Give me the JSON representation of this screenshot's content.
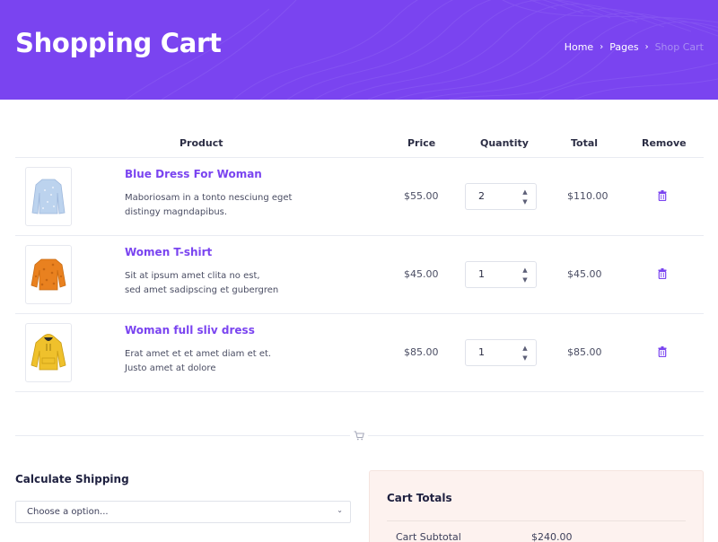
{
  "header": {
    "title": "Shopping Cart",
    "breadcrumb": [
      "Home",
      "Pages",
      "Shop Cart"
    ],
    "background": "#7a44f0"
  },
  "table": {
    "columns": [
      "Product",
      "Price",
      "Quantity",
      "Total",
      "Remove"
    ],
    "rows": [
      {
        "name": "Blue Dress For Woman",
        "desc1": "Maboriosam in a tonto nesciung eget",
        "desc2": "distingy magndapibus.",
        "price": "$55.00",
        "qty": "2",
        "total": "$110.00",
        "image_icon": "sweater-icon",
        "image_color": "#bcd3ee"
      },
      {
        "name": "Women T-shirt",
        "desc1": "Sit at ipsum amet clita no est,",
        "desc2": "sed amet sadipscing et gubergren",
        "price": "$45.00",
        "qty": "1",
        "total": "$45.00",
        "image_icon": "sweater-icon",
        "image_color": "#e9811f"
      },
      {
        "name": "Woman full sliv dress",
        "desc1": "Erat amet et et amet diam et et.",
        "desc2": "Justo amet at dolore",
        "price": "$85.00",
        "qty": "1",
        "total": "$85.00",
        "image_icon": "hoodie-icon",
        "image_color": "#efc12c"
      }
    ]
  },
  "shipping": {
    "title": "Calculate Shipping",
    "select_value": "Choose a option..."
  },
  "totals": {
    "title": "Cart Totals",
    "subtotal_label": "Cart Subtotal",
    "subtotal_value": "$240.00"
  },
  "colors": {
    "accent": "#7a44f0",
    "totals_bg": "#fdf2ef"
  }
}
